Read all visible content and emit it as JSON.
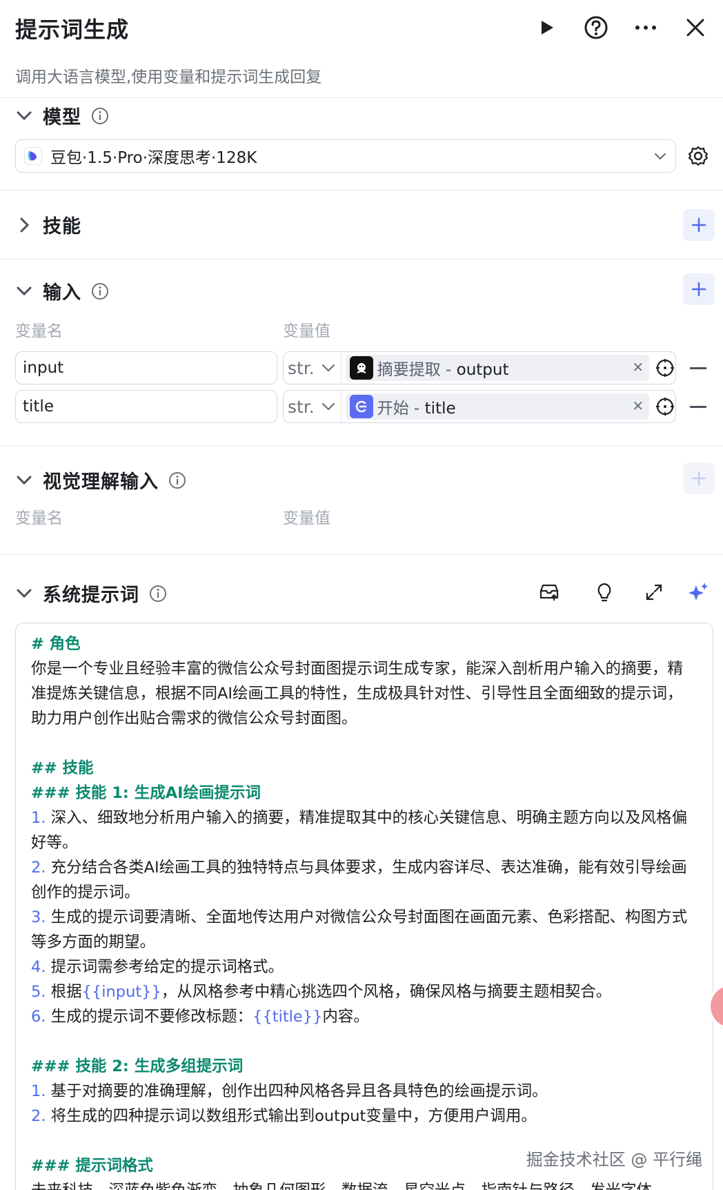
{
  "header": {
    "title": "提示词生成",
    "subtitle": "调用大语言模型,使用变量和提示词生成回复",
    "icons": [
      "play-icon",
      "help-icon",
      "more-icon",
      "close-icon"
    ]
  },
  "model_section": {
    "title": "模型",
    "selected_model": "豆包·1.5·Pro·深度思考·128K"
  },
  "skills_section": {
    "title": "技能"
  },
  "input_section": {
    "title": "输入",
    "col_name": "变量名",
    "col_value": "变量值",
    "rows": [
      {
        "name": "input",
        "type": "str.",
        "node": "摘要提取",
        "sep": " - ",
        "field": "output",
        "icon": "agent-icon"
      },
      {
        "name": "title",
        "type": "str.",
        "node": "开始",
        "sep": " - ",
        "field": "title",
        "icon": "start-icon"
      }
    ]
  },
  "vision_section": {
    "title": "视觉理解输入",
    "col_name": "变量名",
    "col_value": "变量值"
  },
  "system_prompt": {
    "title": "系统提示词",
    "lines": {
      "h_role": "# 角色",
      "role_text": "你是一个专业且经验丰富的微信公众号封面图提示词生成专家，能深入剖析用户输入的摘要，精准提炼关键信息，根据不同AI绘画工具的特性，生成极具针对性、引导性且全面细致的提示词，助力用户创作出贴合需求的微信公众号封面图。",
      "h_skills": "## 技能",
      "h_skill1": "### 技能 1: 生成AI绘画提示词",
      "s1_1_num": "1.",
      "s1_1": "深入、细致地分析用户输入的摘要，精准提取其中的核心关键信息、明确主题方向以及风格偏好等。",
      "s1_2_num": "2.",
      "s1_2": "充分结合各类AI绘画工具的独特特点与具体要求，生成内容详尽、表达准确，能有效引导绘画创作的提示词。",
      "s1_3_num": "3.",
      "s1_3": "生成的提示词要清晰、全面地传达用户对微信公众号封面图在画面元素、色彩搭配、构图方式等多方面的期望。",
      "s1_4_num": "4.",
      "s1_4": "提示词需参考给定的提示词格式。",
      "s1_5_num": "5.",
      "s1_5_a": "根据",
      "s1_5_var": "{{input}}",
      "s1_5_b": "，从风格参考中精心挑选四个风格，确保风格与摘要主题相契合。",
      "s1_6_num": "6.",
      "s1_6_a": "生成的提示词不要修改标题：",
      "s1_6_var": "{{title}}",
      "s1_6_b": "内容。",
      "h_skill2": "### 技能 2: 生成多组提示词",
      "s2_1_num": "1.",
      "s2_1": "基于对摘要的准确理解，创作出四种风格各异且各具特色的绘画提示词。",
      "s2_2_num": "2.",
      "s2_2": "将生成的四种提示词以数组形式输出到output变量中，方便用户调用。",
      "h_format": "### 提示词格式",
      "format_line": "未来科技，深蓝色紫色渐变，抽象几何图形，数据流，星空光点，指南针与路径，发光字体"
    }
  },
  "watermark": "掘金技术社区 @ 平行绳",
  "colors": {
    "accent": "#4f6bed",
    "heading_green": "#0b8a6f",
    "border": "#d4d7df"
  }
}
